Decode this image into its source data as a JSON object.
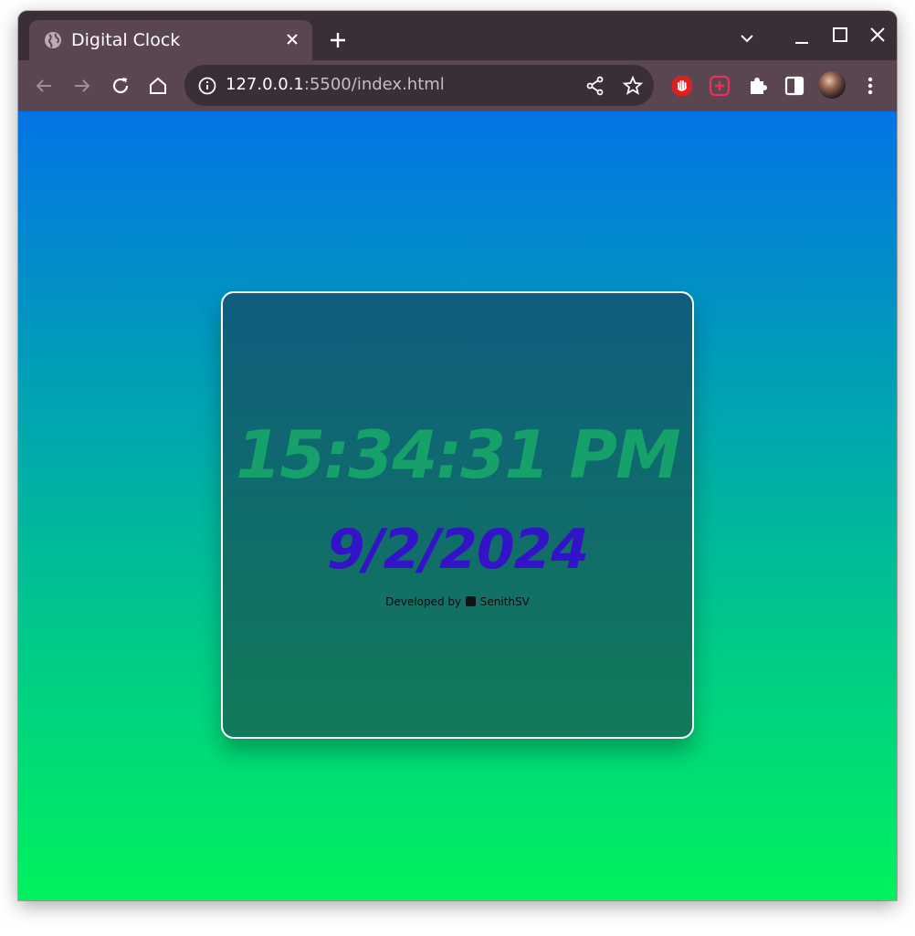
{
  "browser": {
    "tab": {
      "title": "Digital Clock",
      "icon": "globe-icon"
    },
    "address": {
      "host": "127.0.0.1",
      "rest": ":5500/index.html"
    },
    "colors": {
      "tab_strip": "#3a2e37",
      "toolbar": "#5a4651"
    }
  },
  "page": {
    "time": "15:34:31 PM",
    "date": "9/2/2024",
    "credit_prefix": "Developed by",
    "credit_name": "SenithSV",
    "colors": {
      "gradient_top": "#0374e6",
      "gradient_bottom": "#00f25e",
      "time_color": "#16a16a",
      "date_color": "#3213c8"
    }
  }
}
